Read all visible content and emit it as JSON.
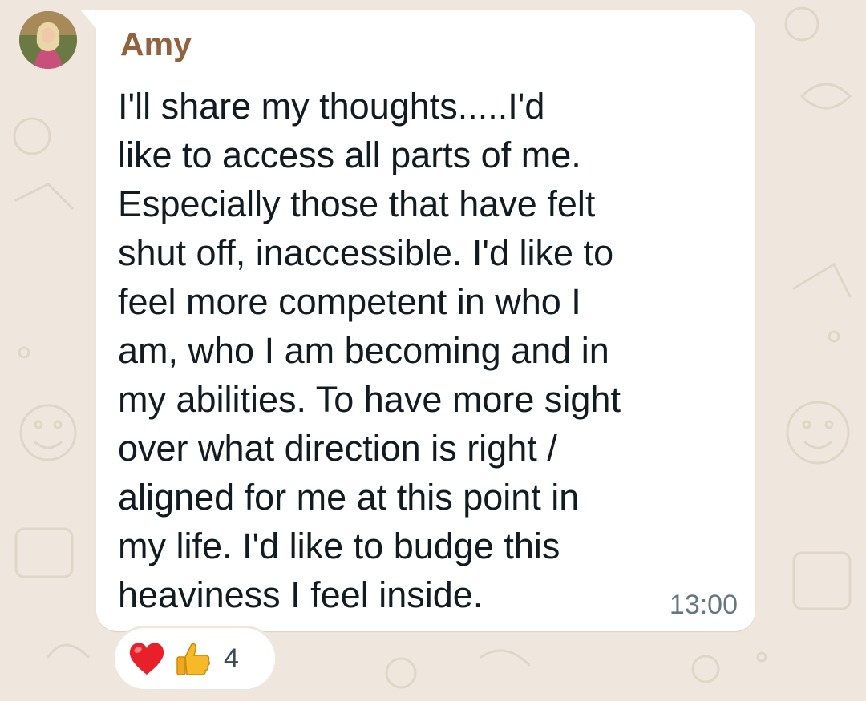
{
  "message": {
    "sender": "Amy",
    "text": "I'll share my thoughts.....I'd\nlike to access all parts of me.\nEspecially those that have felt\nshut off, inaccessible.  I'd like to\nfeel more competent in who I\nam, who I am becoming and in\nmy abilities.  To have more sight\nover what direction is right /\naligned for me at this point in\nmy life.  I'd like to budge this\nheaviness I feel inside.",
    "time": "13:00",
    "sender_color": "#92623e"
  },
  "reactions": {
    "emojis": [
      "heart-icon",
      "thumbs-up-icon"
    ],
    "count": "4"
  },
  "colors": {
    "wallpaper": "#efe7dd",
    "bubble": "#ffffff",
    "text": "#111b21",
    "meta": "#667781"
  }
}
